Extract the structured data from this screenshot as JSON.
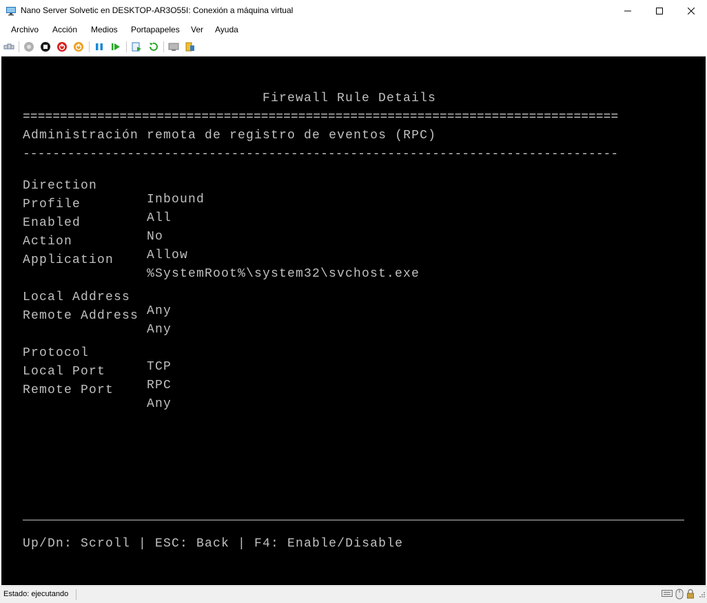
{
  "window": {
    "title": "Nano Server Solvetic en DESKTOP-AR3O55I: Conexión a máquina virtual"
  },
  "menu": {
    "items": [
      "Archivo",
      "Acción",
      "Medios",
      "Portapapeles",
      "Ver",
      "Ayuda"
    ]
  },
  "toolbar": {
    "icons": [
      "ctrl-alt-del-icon",
      "start-icon",
      "turn-off-icon",
      "shut-down-icon",
      "power-icon",
      "pause-icon",
      "resume-icon",
      "checkpoint-icon",
      "revert-icon",
      "enhanced-session-icon",
      "share-icon"
    ]
  },
  "console": {
    "title": "Firewall Rule Details",
    "separator_eq": "================================================================================",
    "rule_name": "Administración remota de registro de eventos (RPC)",
    "separator_dash": "--------------------------------------------------------------------------------",
    "details": [
      {
        "key": "Direction",
        "value": "Inbound"
      },
      {
        "key": "Profile",
        "value": "All"
      },
      {
        "key": "Enabled",
        "value": "No"
      },
      {
        "key": "Action",
        "value": "Allow"
      },
      {
        "key": "Application",
        "value": "%SystemRoot%\\system32\\svchost.exe"
      },
      {
        "key": "Local Address",
        "value": "Any"
      },
      {
        "key": "Remote Address",
        "value": "Any"
      },
      {
        "key": "Protocol",
        "value": "TCP"
      },
      {
        "key": "Local Port",
        "value": "RPC"
      },
      {
        "key": "Remote Port",
        "value": "Any"
      }
    ],
    "footer": "Up/Dn: Scroll | ESC: Back | F4: Enable/Disable"
  },
  "status": {
    "text": "Estado: ejecutando"
  },
  "colors": {
    "console_bg": "#000000",
    "console_fg": "#c0c0c0",
    "statusbar_bg": "#f0f0f0"
  }
}
